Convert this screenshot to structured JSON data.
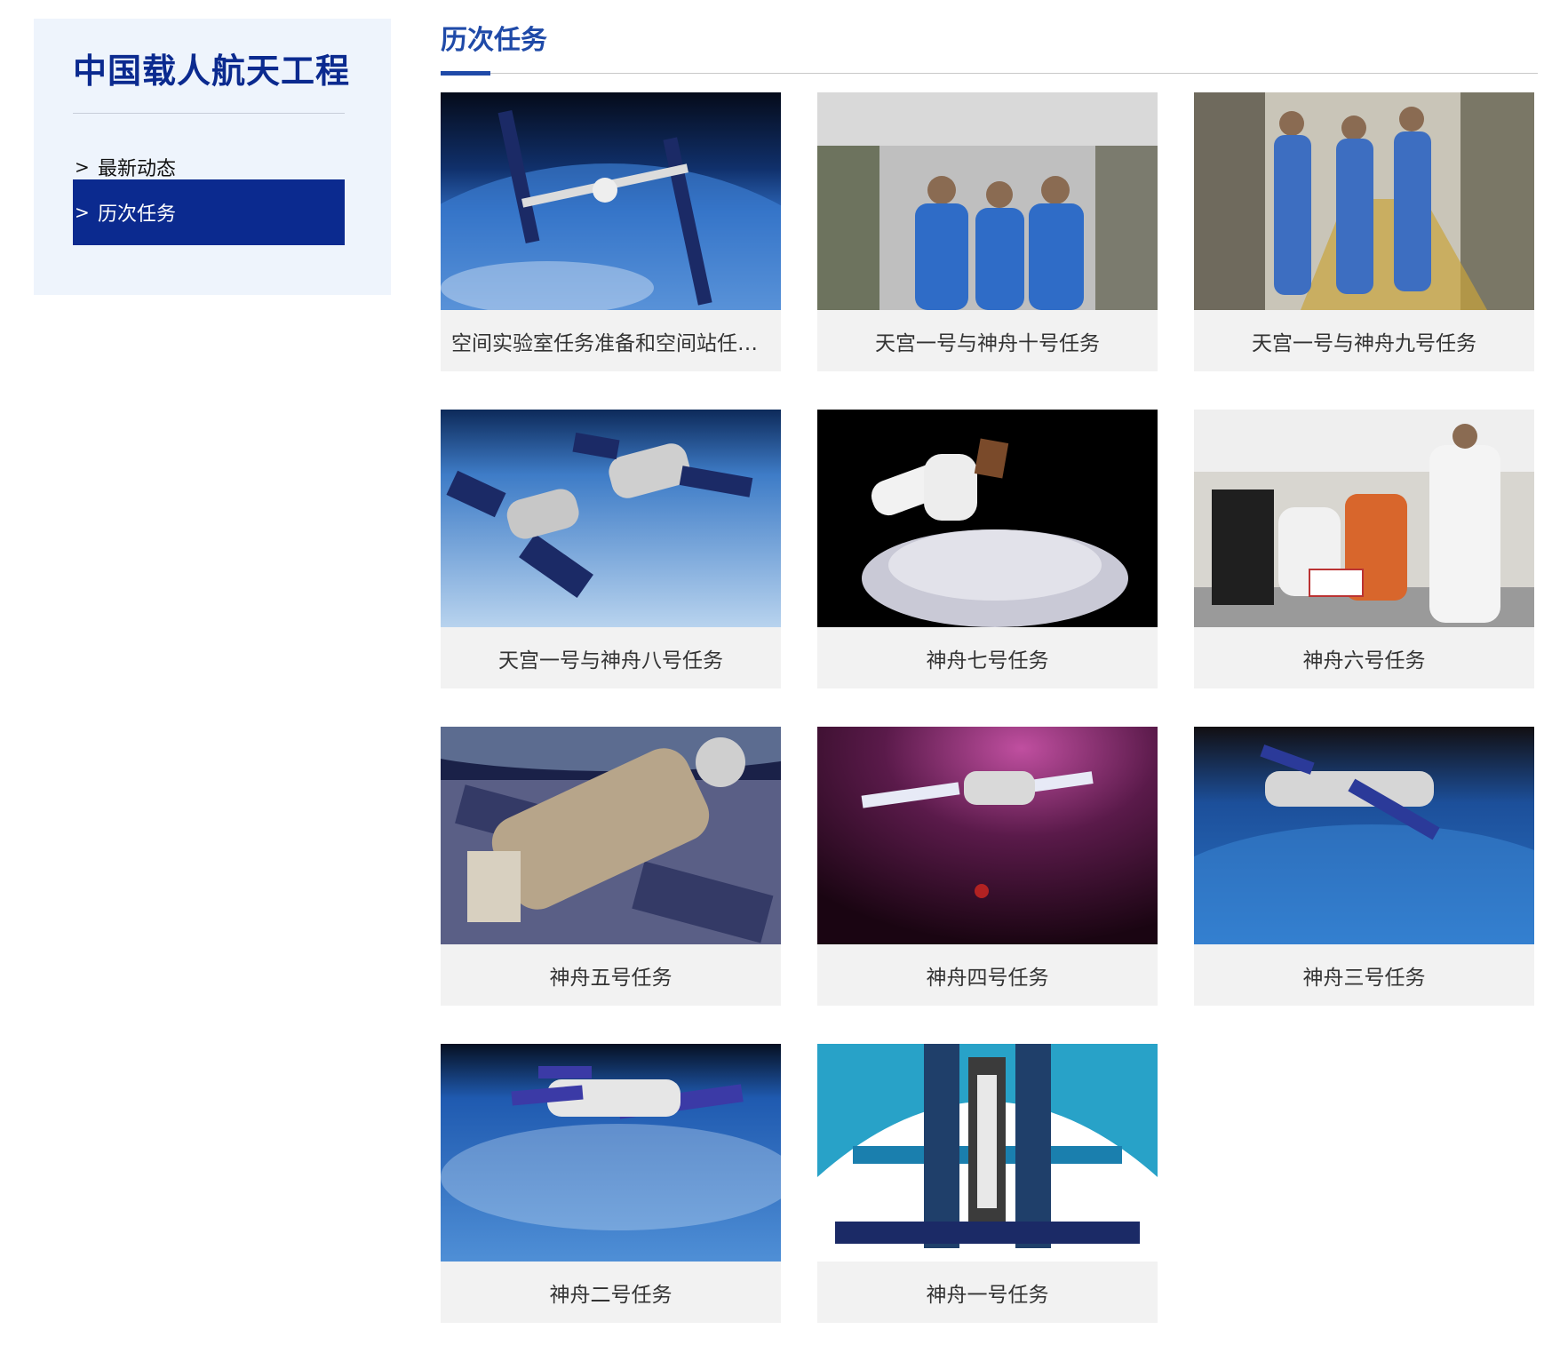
{
  "sidebar": {
    "title": "中国载人航天工程",
    "items": [
      {
        "label": "最新动态",
        "chevron": ">"
      },
      {
        "label": "历次任务",
        "chevron": ">",
        "active": true
      }
    ]
  },
  "main": {
    "section_title": "历次任务",
    "missions": [
      {
        "label": "空间实验室任务准备和空间站任务..."
      },
      {
        "label": "天宫一号与神舟十号任务"
      },
      {
        "label": "天宫一号与神舟九号任务"
      },
      {
        "label": "天宫一号与神舟八号任务"
      },
      {
        "label": "神舟七号任务"
      },
      {
        "label": "神舟六号任务"
      },
      {
        "label": "神舟五号任务"
      },
      {
        "label": "神舟四号任务"
      },
      {
        "label": "神舟三号任务"
      },
      {
        "label": "神舟二号任务"
      },
      {
        "label": "神舟一号任务"
      }
    ]
  },
  "colors": {
    "brand": "#0b2a8f",
    "accent": "#1f4aa8",
    "card_bg": "#f2f2f2",
    "sidebar_bg": "#eef4fc"
  }
}
